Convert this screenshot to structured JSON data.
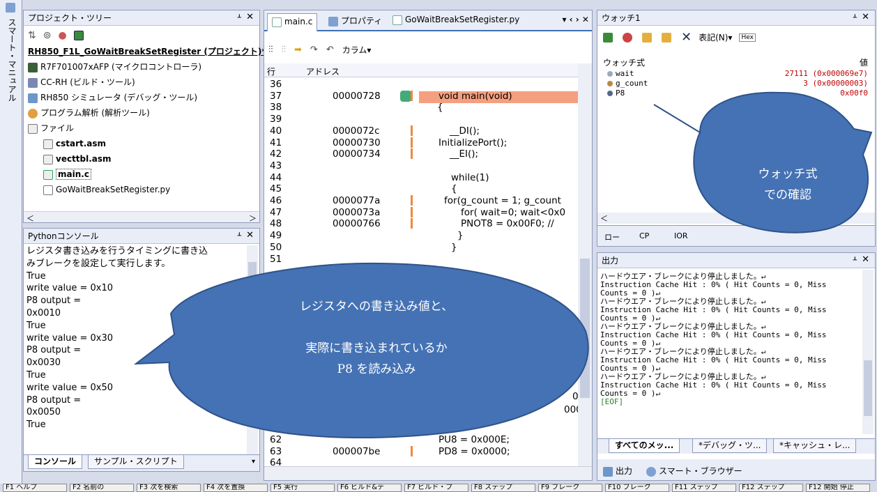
{
  "sidebar_vertical_text": "スマート・マニュアル",
  "project_panel": {
    "title": "プロジェクト・ツリー",
    "pin": "⊥",
    "close": "✕",
    "items": [
      {
        "label": "RH850_F1L_GoWaitBreakSetRegister (プロジェクト)*",
        "indent": 0
      },
      {
        "label": "R7F701007xAFP (マイクロコントローラ)",
        "indent": 1
      },
      {
        "label": "CC-RH (ビルド・ツール)",
        "indent": 1
      },
      {
        "label": "RH850 シミュレータ (デバッグ・ツール)",
        "indent": 1
      },
      {
        "label": "プログラム解析 (解析ツール)",
        "indent": 1
      },
      {
        "label": "ファイル",
        "indent": 1
      },
      {
        "label": "cstart.asm",
        "indent": 2
      },
      {
        "label": "vecttbl.asm",
        "indent": 2
      },
      {
        "label": "main.c",
        "indent": 2
      },
      {
        "label": "GoWaitBreakSetRegister.py",
        "indent": 2
      }
    ]
  },
  "python_panel": {
    "title": "Pythonコンソール",
    "lines": [
      "レジスタ書き込みを行うタイミングに書き込",
      "みブレークを設定して実行します。",
      "True",
      "write value = 0x10",
      "P8 output =",
      "0x0010",
      "True",
      "write value = 0x30",
      "P8 output =",
      "0x0030",
      "True",
      "write value = 0x50",
      "P8 output =",
      "0x0050",
      "True"
    ],
    "tabs": [
      "コンソール",
      "サンプル・スクリプト"
    ]
  },
  "editor": {
    "tabs": [
      "main.c",
      "プロパティ",
      "GoWaitBreakSetRegister.py"
    ],
    "toolbar_column": "カラム▾",
    "headers": {
      "line": "行",
      "address": "アドレス"
    },
    "rows": [
      {
        "ln": "36",
        "addr": "",
        "src": ""
      },
      {
        "ln": "37",
        "addr": "00000728",
        "src": "void main(void)"
      },
      {
        "ln": "38",
        "addr": "",
        "src": "{"
      },
      {
        "ln": "39",
        "addr": "",
        "src": ""
      },
      {
        "ln": "40",
        "addr": "0000072c",
        "src": "__DI();"
      },
      {
        "ln": "41",
        "addr": "00000730",
        "src": "InitializePort();"
      },
      {
        "ln": "42",
        "addr": "00000734",
        "src": "__EI();"
      },
      {
        "ln": "43",
        "addr": "",
        "src": ""
      },
      {
        "ln": "44",
        "addr": "",
        "src": "while(1)"
      },
      {
        "ln": "45",
        "addr": "",
        "src": "{"
      },
      {
        "ln": "46",
        "addr": "0000077a",
        "src": "for(g_count = 1; g_count"
      },
      {
        "ln": "47",
        "addr": "0000073a",
        "src": "for( wait=0; wait<0x0"
      },
      {
        "ln": "48",
        "addr": "00000766",
        "src": "PNOT8 = 0x00F0; //"
      },
      {
        "ln": "49",
        "addr": "",
        "src": "}"
      },
      {
        "ln": "50",
        "addr": "",
        "src": "}"
      },
      {
        "ln": "51",
        "addr": "",
        "src": ""
      }
    ],
    "bottom_rows": [
      {
        "ln": "62",
        "addr": "",
        "src": "PU8 = 0x000E;"
      },
      {
        "ln": "63",
        "addr": "000007be",
        "src": "PD8 = 0x0000;"
      },
      {
        "ln": "64",
        "addr": "",
        "src": ""
      }
    ],
    "partial_right_1": "00;",
    "partial_right_2": "0000;"
  },
  "watch_panel": {
    "title": "ウォッチ1",
    "notation": "表記(N)▾",
    "headers": {
      "expr": "ウォッチ式",
      "value": "値"
    },
    "rows": [
      {
        "name": "wait",
        "value": "27111 (0x000069e7)"
      },
      {
        "name": "g_count",
        "value": "3 (0x00000003)"
      },
      {
        "name": "P8",
        "value": "0x00f0"
      }
    ],
    "bottom_tabs": [
      "ロー",
      "CP",
      "IOR"
    ]
  },
  "output_panel": {
    "title": "出力",
    "lines": [
      "ハードウエア・ブレークにより停止しました。↵",
      "Instruction Cache Hit : 0% ( Hit Counts = 0, Miss",
      " Counts = 0 )↵",
      "ハードウエア・ブレークにより停止しました。↵",
      "Instruction Cache Hit : 0% ( Hit Counts = 0, Miss",
      " Counts = 0 )↵",
      "ハードウエア・ブレークにより停止しました。↵",
      "Instruction Cache Hit : 0% ( Hit Counts = 0, Miss",
      " Counts = 0 )↵",
      "ハードウエア・ブレークにより停止しました。↵",
      "Instruction Cache Hit : 0% ( Hit Counts = 0, Miss",
      " Counts = 0 )↵",
      "ハードウエア・ブレークにより停止しました。↵",
      "Instruction Cache Hit : 0% ( Hit Counts = 0, Miss",
      " Counts = 0 )↵",
      "[EOF]"
    ],
    "tabs": [
      "すべてのメッ...",
      "*デバッグ・ツ...",
      "*キャッシュ・レ..."
    ],
    "footer_tabs": [
      "出力",
      "スマート・ブラウザー"
    ]
  },
  "callouts": {
    "watch": [
      "ウォッチ式",
      "での確認"
    ],
    "main": [
      "レジスタへの書き込み値と、",
      "実際に書き込まれているか",
      "P8 を読み込み"
    ]
  },
  "fkeys": [
    "F1 ヘルプ",
    "F2 名前の",
    "F3 次を検索",
    "F4 次を置換",
    "F5 実行",
    "F6 ビルド&デ",
    "F7 ビルド・プ",
    "F8 ステップ",
    "F9 ブレーク",
    "F10 ブレーク",
    "F11 ステップ",
    "F12 ステップ",
    "F12 開始 停止"
  ],
  "colors": {
    "accent": "#3e6fb0",
    "highlight": "#f4a080",
    "callout": "#4472b4"
  }
}
